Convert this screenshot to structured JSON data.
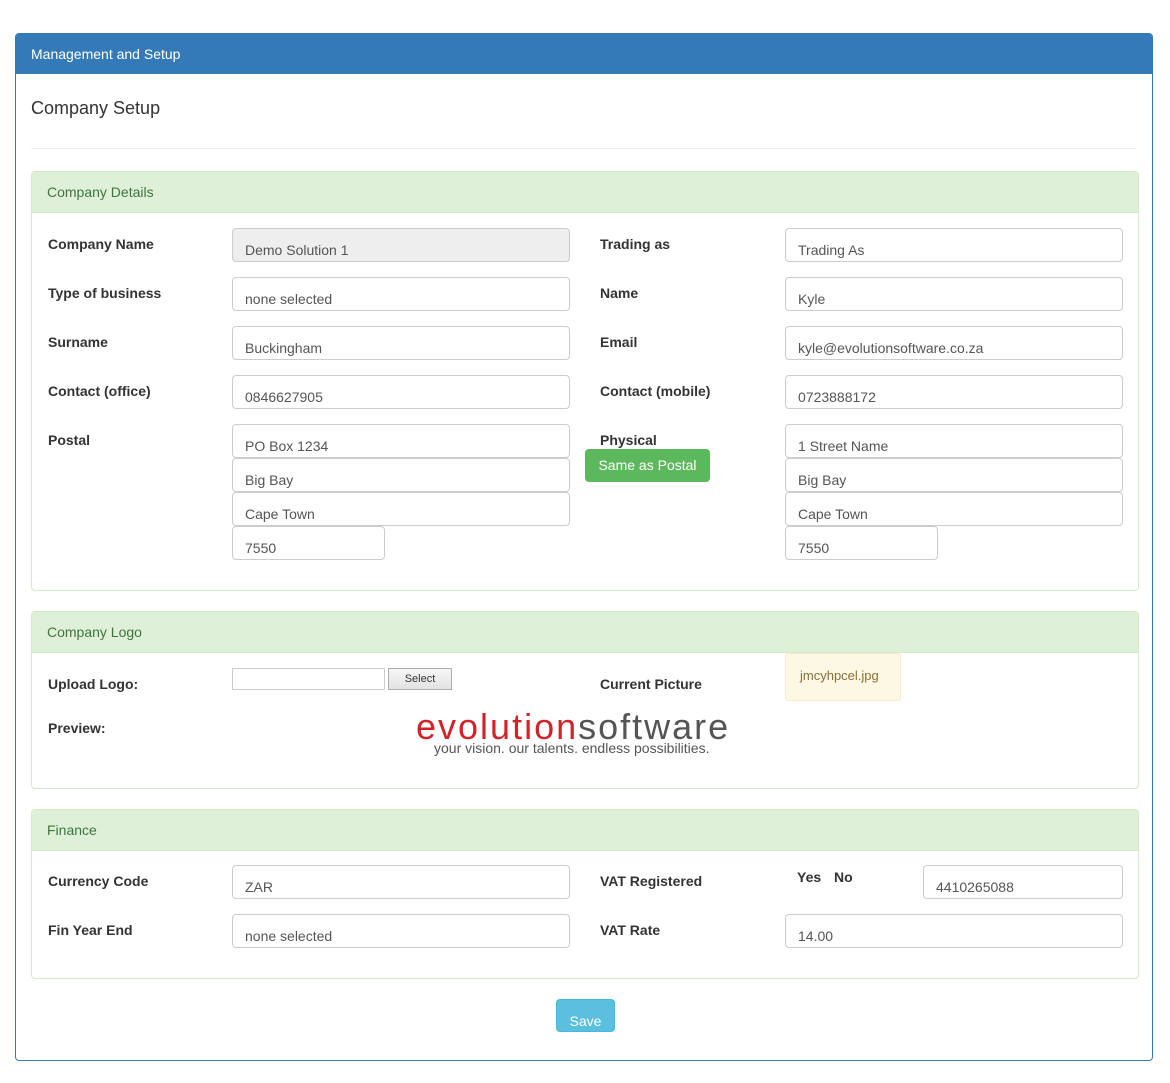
{
  "header": {
    "title": "Management and Setup"
  },
  "page": {
    "title": "Company Setup"
  },
  "company_details": {
    "heading": "Company Details",
    "company_name_label": "Company Name",
    "company_name_value": "Demo Solution 1",
    "trading_as_label": "Trading as",
    "trading_as_value": "Trading As",
    "type_of_business_label": "Type of business",
    "type_of_business_value": "none selected",
    "name_label": "Name",
    "name_value": "Kyle",
    "surname_label": "Surname",
    "surname_value": "Buckingham",
    "email_label": "Email",
    "email_value": "kyle@evolutionsoftware.co.za",
    "contact_office_label": "Contact (office)",
    "contact_office_value": "0846627905",
    "contact_mobile_label": "Contact (mobile)",
    "contact_mobile_value": "0723888172",
    "postal_label": "Postal",
    "postal_lines": [
      "PO Box 1234",
      "Big Bay",
      "Cape Town",
      "7550"
    ],
    "physical_label": "Physical",
    "physical_lines": [
      "1 Street Name",
      "Big Bay",
      "Cape Town",
      "7550"
    ],
    "same_as_postal_label": "Same as Postal"
  },
  "company_logo": {
    "heading": "Company Logo",
    "upload_label": "Upload Logo:",
    "select_button": "Select",
    "current_picture_label": "Current Picture",
    "current_picture_file": "jmcyhpcel.jpg",
    "preview_label": "Preview:",
    "logo_word_red": "evolution",
    "logo_word_grey": "software",
    "logo_tagline": "your vision.  our talents.  endless possibilities."
  },
  "finance": {
    "heading": "Finance",
    "currency_code_label": "Currency Code",
    "currency_code_value": "ZAR",
    "vat_registered_label": "VAT Registered",
    "yes_label": "Yes",
    "no_label": "No",
    "vat_number_value": "4410265088",
    "fin_year_end_label": "Fin Year End",
    "fin_year_end_value": "none selected",
    "vat_rate_label": "VAT Rate",
    "vat_rate_value": "14.00"
  },
  "save_button": "Save",
  "colors": {
    "primary": "#337ab7",
    "success": "#5cb85c",
    "info": "#5bc0de",
    "section_bg": "#dff0d8",
    "section_text": "#3c763d",
    "logo_red": "#d1232a"
  }
}
